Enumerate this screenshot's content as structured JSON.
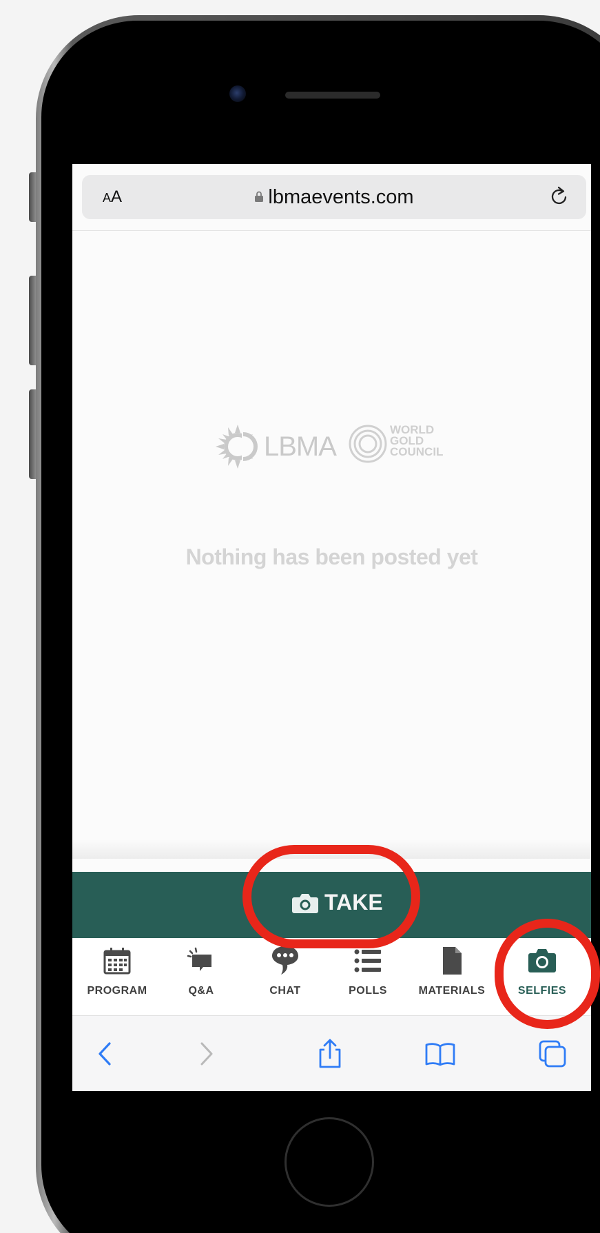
{
  "browser": {
    "text_size_label": "AA",
    "url": "lbmaevents.com"
  },
  "brand": {
    "lbma_logo_text": "LBMA",
    "wgc_logo_lines": [
      "WORLD",
      "GOLD",
      "COUNCIL"
    ]
  },
  "feed": {
    "empty_message": "Nothing has been posted yet"
  },
  "take_bar": {
    "button_label": "TAKE"
  },
  "tabs": [
    {
      "label": "PROGRAM",
      "icon": "calendar-icon"
    },
    {
      "label": "Q&A",
      "icon": "qa-icon"
    },
    {
      "label": "CHAT",
      "icon": "chat-icon"
    },
    {
      "label": "POLLS",
      "icon": "list-icon"
    },
    {
      "label": "MATERIALS",
      "icon": "document-icon"
    },
    {
      "label": "SELFIES",
      "icon": "camera-icon",
      "active": true
    }
  ],
  "toolbar_icons": [
    "back-icon",
    "forward-icon",
    "share-icon",
    "bookmarks-icon",
    "tabs-icon"
  ],
  "colors": {
    "accent": "#285e56",
    "highlight": "#e8261a",
    "ios_blue": "#2f7cf6"
  }
}
